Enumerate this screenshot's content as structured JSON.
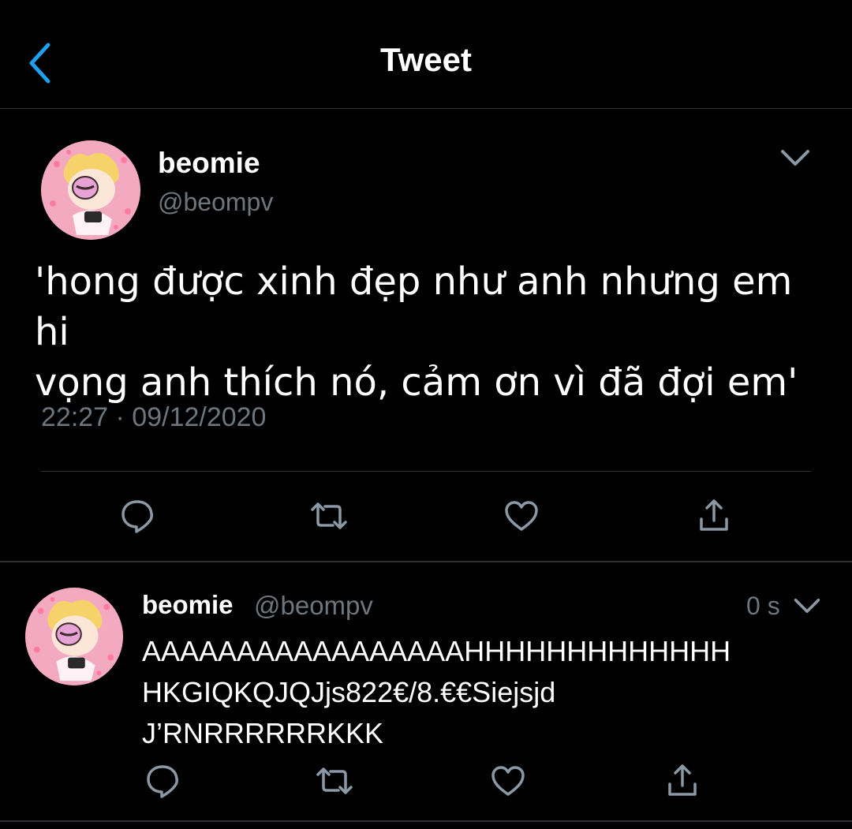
{
  "header": {
    "title": "Tweet"
  },
  "tweet": {
    "author_name": "beomie",
    "author_handle": "@beompv",
    "text_line1": "'hong được xinh đẹp như anh nhưng em hi",
    "text_line2": "vọng anh thích nó, cảm ơn vì đã đợi em'",
    "time": "22:27 · 09/12/2020"
  },
  "reply": {
    "author_name": "beomie",
    "author_handle": "@beompv",
    "age": "0 s",
    "text_line1": "AAAAAAAAAAAAAAAAAHHHHHHHHHHHHH",
    "text_line2": "HKGIQKQJQJjs822€/8.€€Siejsjd",
    "text_line3": "J’RNRRRRRRKKK"
  },
  "icons": {
    "back": "chevron-left-icon",
    "more": "chevron-down-icon",
    "reply": "comment-bubble-icon",
    "retweet": "retweet-icon",
    "like": "heart-icon",
    "share": "share-icon"
  },
  "colors": {
    "background": "#000000",
    "accent": "#1da1f2",
    "secondary_text": "#6e767d",
    "divider": "#2f3336",
    "avatar_pink": "#ef8fb0"
  }
}
